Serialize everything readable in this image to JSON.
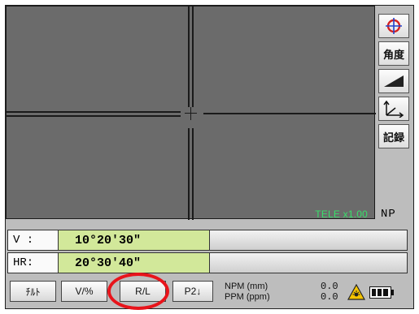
{
  "viewfinder": {
    "zoom_label": "TELE x1.00",
    "prism_mode": "NP"
  },
  "side_toolbar": {
    "target_icon": "crosshair-target-icon",
    "angle_label": "角度",
    "slope_icon": "slope-ramp-icon",
    "coordinate_icon": "coordinate-axes-icon",
    "record_label": "記録"
  },
  "readouts": [
    {
      "label": "V :",
      "value": "10°20'30\""
    },
    {
      "label": "HR:",
      "value": "20°30'40\""
    }
  ],
  "function_keys": [
    {
      "label": "ﾁﾙﾄ"
    },
    {
      "label": "V/%"
    },
    {
      "label": "R/L"
    },
    {
      "label": "P2↓"
    }
  ],
  "status": {
    "npm_label": "NPM (mm)",
    "ppm_label": "PPM (ppm)",
    "npm_value": "0.0",
    "ppm_value": "0.0",
    "laser_icon": "laser-warning-icon",
    "battery_icon": "battery-icon"
  },
  "colors": {
    "zoom_text": "#37e06a",
    "readout_value_bg": "#d2e89a",
    "highlight": "#e8141b",
    "target_icon": "#d42020"
  }
}
